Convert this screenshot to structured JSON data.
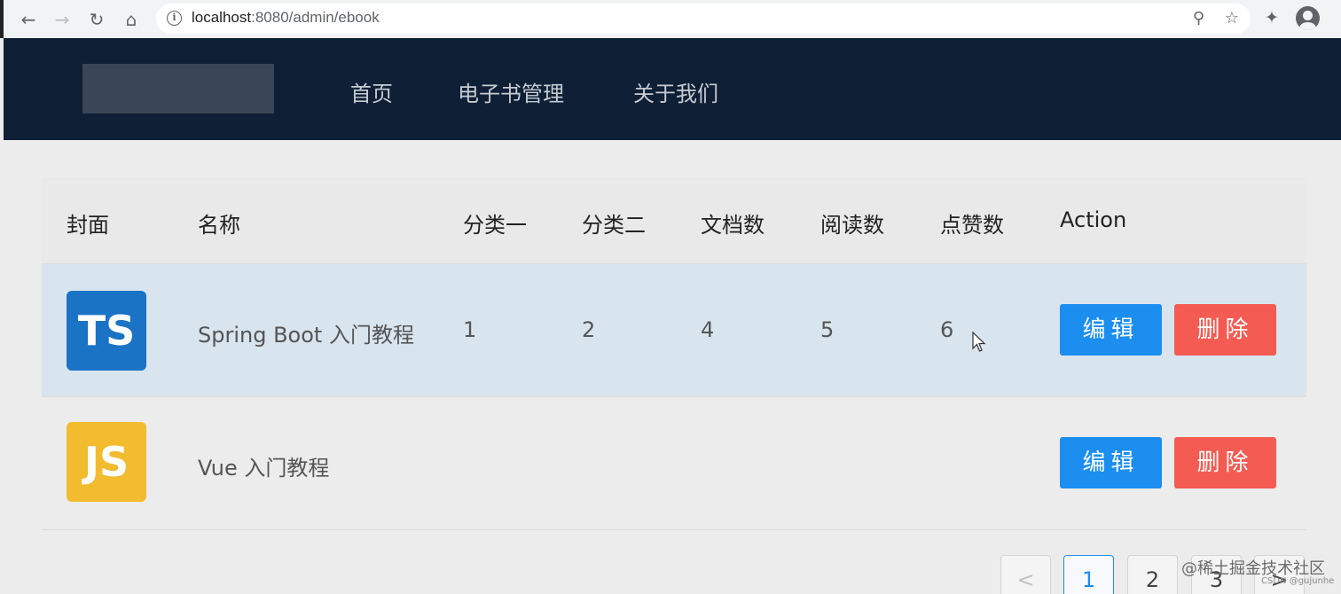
{
  "browser": {
    "url_host": "localhost",
    "url_rest": ":8080/admin/ebook"
  },
  "nav": {
    "items": [
      {
        "label": "首页"
      },
      {
        "label": "电子书管理"
      },
      {
        "label": "关于我们"
      }
    ]
  },
  "table": {
    "columns": [
      "封面",
      "名称",
      "分类一",
      "分类二",
      "文档数",
      "阅读数",
      "点赞数",
      "Action"
    ],
    "rows": [
      {
        "cover_text": "TS",
        "cover_color": "#1b73c6",
        "name": "Spring Boot 入门教程",
        "category1": "1",
        "category2": "2",
        "doc_count": "4",
        "view_count": "5",
        "vote_count": "6",
        "edit_label": "编辑",
        "delete_label": "删除",
        "highlighted": true
      },
      {
        "cover_text": "JS",
        "cover_color": "#f3bb2e",
        "name": "Vue 入门教程",
        "category1": "",
        "category2": "",
        "doc_count": "",
        "view_count": "",
        "vote_count": "",
        "edit_label": "编辑",
        "delete_label": "删除",
        "highlighted": false
      }
    ]
  },
  "pagination": {
    "prev": "<",
    "pages": [
      "1",
      "2",
      "3"
    ],
    "current": 1,
    "next": ">"
  },
  "watermark": {
    "text": "@稀土掘金技术社区",
    "sub": "CSDN @gujunhe"
  },
  "colors": {
    "header_bg": "#0e1f36",
    "primary": "#1b8ef0",
    "danger": "#f45b52",
    "row_highlight": "#d8e4ee"
  }
}
